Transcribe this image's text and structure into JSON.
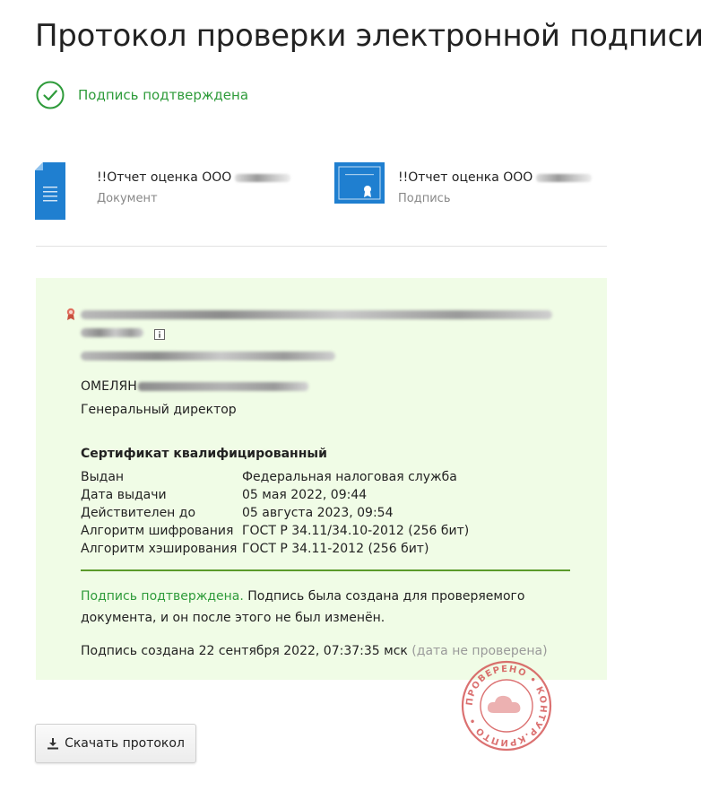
{
  "page": {
    "title": "Протокол проверки электронной подписи"
  },
  "status": {
    "text": "Подпись подтверждена",
    "color": "#2e9b3a",
    "icon": "check-circle-icon"
  },
  "files": [
    {
      "name": "!!Отчет оценка ООО",
      "type": "Документ",
      "icon": "document-icon"
    },
    {
      "name": "!!Отчет оценка ООО",
      "type": "Подпись",
      "icon": "signature-certificate-icon"
    }
  ],
  "certificate": {
    "owner": "ОМЕЛЯН",
    "position": "Генеральный директор",
    "title": "Сертификат квалифицированный",
    "details": [
      {
        "label": "Выдан",
        "value": "Федеральная налоговая служба"
      },
      {
        "label": "Дата выдачи",
        "value": "05 мая 2022, 09:44"
      },
      {
        "label": "Действителен до",
        "value": "05 августа 2023, 09:54"
      },
      {
        "label": "Алгоритм шифрования",
        "value": "ГОСТ Р 34.11/34.10-2012 (256 бит)"
      },
      {
        "label": "Алгоритм хэширования",
        "value": "ГОСТ Р 34.11-2012 (256 бит)"
      }
    ]
  },
  "verification": {
    "status": "Подпись подтверждена.",
    "message": "Подпись была создана для проверяемого документа, и он после этого не был изменён.",
    "created": "Подпись создана 22 сентября 2022, 07:37:35 мск",
    "created_note": "(дата не проверена)"
  },
  "stamp": {
    "text": "ПРОВЕРЕНО • КОНТУР.КРИПТО •",
    "color": "#d24a4a"
  },
  "download": {
    "label": "Скачать протокол",
    "icon": "download-icon"
  },
  "colors": {
    "accent_green": "#2e9b3a",
    "panel_background": "#f0fce6",
    "file_icon_blue": "#1f7fd0"
  }
}
